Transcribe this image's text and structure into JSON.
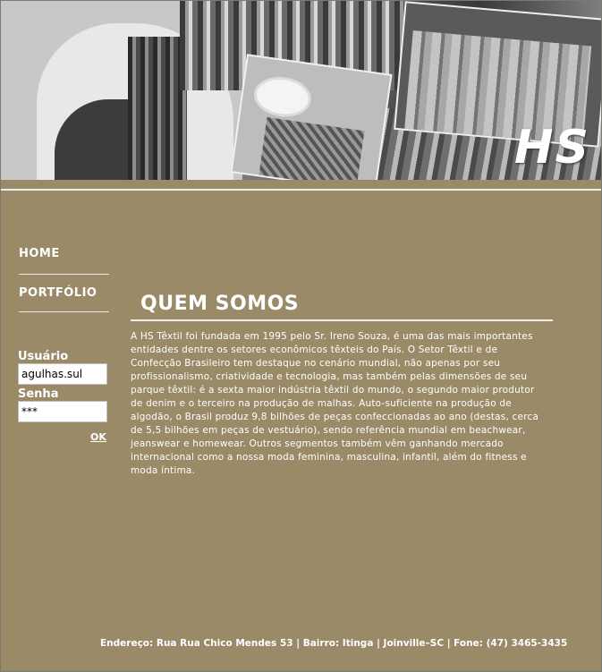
{
  "header": {
    "logo_text": "HS"
  },
  "nav": {
    "items": [
      {
        "label": "HOME"
      },
      {
        "label": "PORTFÓLIO"
      }
    ]
  },
  "login": {
    "user_label": "Usuário",
    "user_value": "agulhas.sul",
    "password_label": "Senha",
    "password_value": "***",
    "ok_label": "OK"
  },
  "content": {
    "title": "QUEM SOMOS",
    "body": "A HS Têxtil foi fundada em 1995 pelo Sr. Ireno Souza,  é uma das mais importantes entidades dentre os setores econômicos têxteis do País. O Setor Têxtil e de Confecção Brasileiro tem destaque no cenário mundial, não apenas por seu profissionalismo, criatividade e tecnologia, mas também pelas dimensões de seu parque têxtil: é a sexta maior indústria têxtil do mundo, o segundo maior produtor de denim e o terceiro na produção de malhas. Auto-suficiente na produção de algodão, o Brasil produz 9,8 bilhões de peças confeccionadas ao ano (destas, cerca de 5,5 bilhões em peças de vestuário), sendo referência mundial em beachwear, jeanswear e homewear. Outros segmentos também vêm ganhando mercado internacional como a nossa moda feminina, masculina, infantil, além do fitness e moda íntima."
  },
  "footer": {
    "address": "Endereço: Rua Rua Chico Mendes 53 | Bairro: Itinga | Joinville–SC | Fone: (47) 3465-3435"
  },
  "colors": {
    "background": "#9a8a68",
    "text": "#ffffff"
  }
}
